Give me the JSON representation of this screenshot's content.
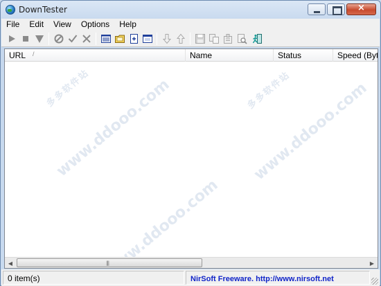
{
  "window": {
    "title": "DownTester",
    "controls": [
      "minimize-icon",
      "maximize-icon",
      "close-icon"
    ]
  },
  "menu": [
    "File",
    "Edit",
    "View",
    "Options",
    "Help"
  ],
  "toolbar": [
    {
      "name": "start-button",
      "icon": "play-icon",
      "color": "#8a8a8a"
    },
    {
      "name": "stop-button",
      "icon": "stop-icon",
      "color": "#8a8a8a"
    },
    {
      "name": "pause-button",
      "icon": "down-triangle-icon",
      "color": "#8a8a8a"
    },
    {
      "name": "cancel-button",
      "icon": "prohibit-icon",
      "color": "#8a8a8a"
    },
    {
      "name": "check-button",
      "icon": "checkmark-icon",
      "color": "#8a8a8a"
    },
    {
      "name": "remove-button",
      "icon": "x-icon",
      "color": "#8a8a8a"
    },
    {
      "name": "enter-urls-button",
      "icon": "list-window-icon",
      "color": "#1f3f9a"
    },
    {
      "name": "open-folder-button",
      "icon": "folder-icon",
      "color": "#e7c440"
    },
    {
      "name": "load-file-button",
      "icon": "document-plus-icon",
      "color": "#1f3f9a"
    },
    {
      "name": "options-button",
      "icon": "window-icon",
      "color": "#1f3f9a"
    },
    {
      "name": "move-down-button",
      "icon": "arrow-down-icon",
      "color": "#a9a9a9"
    },
    {
      "name": "move-up-button",
      "icon": "arrow-up-icon",
      "color": "#a9a9a9"
    },
    {
      "name": "save-button",
      "icon": "floppy-disk-icon",
      "color": "#a9a9a9"
    },
    {
      "name": "copy-button",
      "icon": "copy-icon",
      "color": "#a9a9a9"
    },
    {
      "name": "properties-button",
      "icon": "properties-icon",
      "color": "#a9a9a9"
    },
    {
      "name": "find-button",
      "icon": "find-icon",
      "color": "#a9a9a9"
    },
    {
      "name": "exit-button",
      "icon": "exit-door-icon",
      "color": "#1e9e9a"
    }
  ],
  "list": {
    "columns": [
      "URL",
      "Name",
      "Status",
      "Speed (Byte"
    ],
    "sort_indicator": "/",
    "rows": []
  },
  "watermark": {
    "url_text": "www.ddooo.com",
    "cn_text": "多多软件站"
  },
  "status": {
    "items": "0 item(s)",
    "credit": "NirSoft Freeware.  http://www.nirsoft.net"
  }
}
